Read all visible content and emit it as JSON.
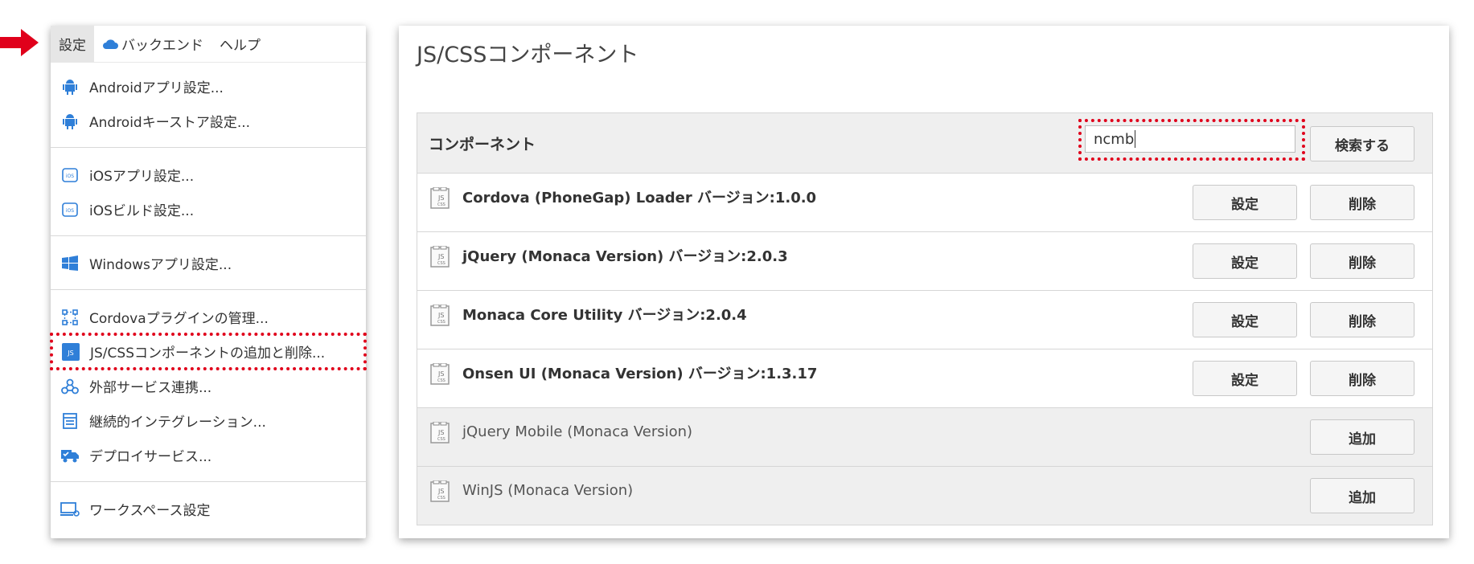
{
  "menubar": {
    "settings": "設定",
    "backend": "バックエンド",
    "help": "ヘルプ"
  },
  "menu": {
    "android_app": "Androidアプリ設定...",
    "android_keystore": "Androidキーストア設定...",
    "ios_app": "iOSアプリ設定...",
    "ios_build": "iOSビルド設定...",
    "windows_app": "Windowsアプリ設定...",
    "cordova_plugins": "Cordovaプラグインの管理...",
    "jscss_components": "JS/CSSコンポーネントの追加と削除...",
    "external_services": "外部サービス連携...",
    "ci": "継続的インテグレーション...",
    "deploy": "デプロイサービス...",
    "workspace": "ワークスペース設定"
  },
  "panel": {
    "title": "JS/CSSコンポーネント",
    "header_label": "コンポーネント",
    "search_value": "ncmb",
    "search_button": "検索する",
    "settings_label": "設定",
    "remove_label": "削除",
    "add_label": "追加"
  },
  "installed": [
    {
      "name": "Cordova (PhoneGap) Loader バージョン:1.0.0"
    },
    {
      "name": "jQuery (Monaca Version) バージョン:2.0.3"
    },
    {
      "name": "Monaca Core Utility バージョン:2.0.4"
    },
    {
      "name": "Onsen UI (Monaca Version) バージョン:1.3.17"
    }
  ],
  "available": [
    {
      "name": "jQuery Mobile (Monaca Version)"
    },
    {
      "name": "WinJS (Monaca Version)"
    }
  ],
  "colors": {
    "highlight": "#e0001b",
    "accent_blue": "#2f7fd8"
  }
}
